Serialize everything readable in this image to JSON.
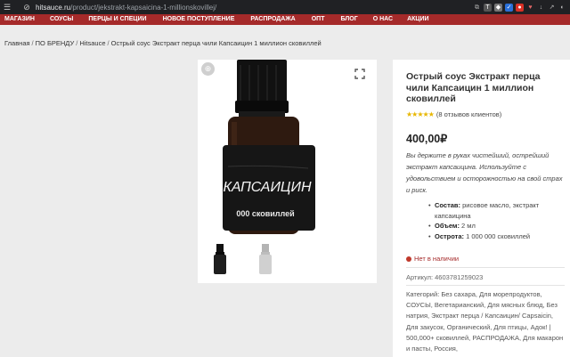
{
  "browser": {
    "url_domain": "hitsauce.ru",
    "url_path": "/product/jekstrakt-kapsaicina-1-millionskovillej/"
  },
  "nav": {
    "items": [
      {
        "label": "МАГАЗИН"
      },
      {
        "label": "СОУСЫ"
      },
      {
        "label": "ПЕРЦЫ И СПЕЦИИ"
      },
      {
        "label": "НОВОЕ ПОСТУПЛЕНИЕ"
      },
      {
        "label": "РАСПРОДАЖА"
      },
      {
        "label": "ОПТ"
      },
      {
        "label": "БЛОГ"
      },
      {
        "label": "О НАС"
      },
      {
        "label": "АКЦИИ"
      }
    ]
  },
  "breadcrumb": {
    "items": [
      "Главная",
      "ПО БРЕНДУ",
      "Hitsauce",
      "Острый соус Экстракт перца чили Капсаицин 1 миллион сковиллей"
    ],
    "separator": "/"
  },
  "gallery": {
    "label_line1": "КАПСАИЦИН",
    "label_line2": "000 сковиллей",
    "thumbnail_count": 2
  },
  "product": {
    "title": "Острый соус Экстракт перца чили Капсаицин 1 миллион сковиллей",
    "rating": 5,
    "stars": "★★★★★",
    "review_text": "(8 отзывов клиентов)",
    "price": "400,00₽",
    "description": "Вы держите в руках чистейший, острейший экстракт капсаицина. Используйте с удовольствием и осторожностью на свой страх и риск.",
    "specs": [
      {
        "key": "Состав:",
        "value": "рисовое масло, экстракт капсаицина"
      },
      {
        "key": "Объем:",
        "value": "2 мл"
      },
      {
        "key": "Острота:",
        "value": "1 000 000 сковиллей"
      }
    ],
    "stock_status": "Нет в наличии",
    "sku": "Артикул: 4603781259023",
    "categories": "Категорий: Без сахара, Для морепродуктов, СОУСЫ, Вегетарианский, Для мясных блюд, Без натрия, Экстракт перца / Капсаицин/ Capsaicin, Для закусок, Органический, Для птицы, Адок! | 500,000+ сковиллей, РАСПРОДАЖА, Для макарон и пасты, Россия,"
  },
  "colors": {
    "nav_bg": "#a52a2a",
    "stock_red": "#c0392b",
    "star_gold": "#e8b700"
  }
}
